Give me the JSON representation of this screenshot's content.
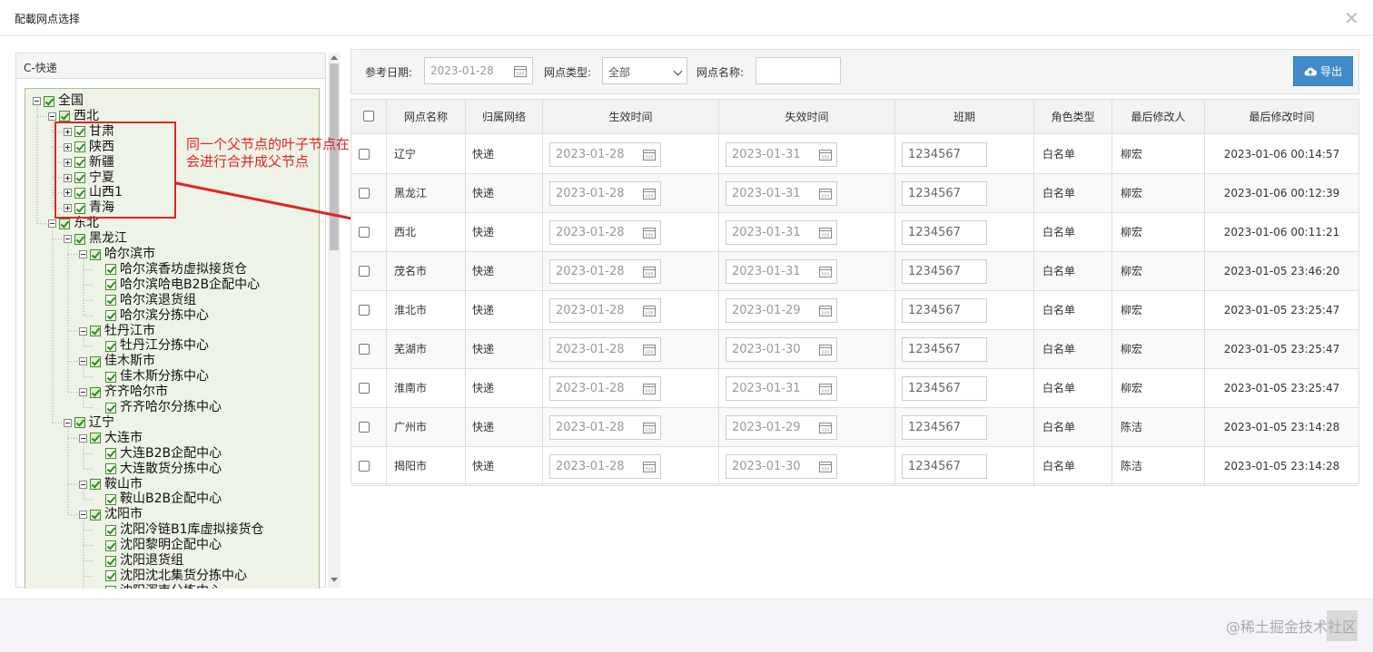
{
  "modal": {
    "title": "配載网点选择"
  },
  "tree": {
    "title": "C-快递",
    "nodes": [
      {
        "label": "全国",
        "level": 0,
        "expander": "minus"
      },
      {
        "label": "西北",
        "level": 1,
        "expander": "minus"
      },
      {
        "label": "甘肃",
        "level": 2,
        "expander": "plus"
      },
      {
        "label": "陕西",
        "level": 2,
        "expander": "plus"
      },
      {
        "label": "新疆",
        "level": 2,
        "expander": "plus"
      },
      {
        "label": "宁夏",
        "level": 2,
        "expander": "plus"
      },
      {
        "label": "山西1",
        "level": 2,
        "expander": "plus"
      },
      {
        "label": "青海",
        "level": 2,
        "expander": "plus"
      },
      {
        "label": "东北",
        "level": 1,
        "expander": "minus"
      },
      {
        "label": "黑龙江",
        "level": 2,
        "expander": "minus"
      },
      {
        "label": "哈尔滨市",
        "level": 3,
        "expander": "minus"
      },
      {
        "label": "哈尔滨香坊虚拟接货仓",
        "level": 4,
        "expander": "none"
      },
      {
        "label": "哈尔滨哈电B2B企配中心",
        "level": 4,
        "expander": "none"
      },
      {
        "label": "哈尔滨退货组",
        "level": 4,
        "expander": "none"
      },
      {
        "label": "哈尔滨分拣中心",
        "level": 4,
        "expander": "none"
      },
      {
        "label": "牡丹江市",
        "level": 3,
        "expander": "minus"
      },
      {
        "label": "牡丹江分拣中心",
        "level": 4,
        "expander": "none"
      },
      {
        "label": "佳木斯市",
        "level": 3,
        "expander": "minus"
      },
      {
        "label": "佳木斯分拣中心",
        "level": 4,
        "expander": "none"
      },
      {
        "label": "齐齐哈尔市",
        "level": 3,
        "expander": "minus"
      },
      {
        "label": "齐齐哈尔分拣中心",
        "level": 4,
        "expander": "none"
      },
      {
        "label": "辽宁",
        "level": 2,
        "expander": "minus"
      },
      {
        "label": "大连市",
        "level": 3,
        "expander": "minus"
      },
      {
        "label": "大连B2B企配中心",
        "level": 4,
        "expander": "none"
      },
      {
        "label": "大连散货分拣中心",
        "level": 4,
        "expander": "none"
      },
      {
        "label": "鞍山市",
        "level": 3,
        "expander": "minus"
      },
      {
        "label": "鞍山B2B企配中心",
        "level": 4,
        "expander": "none"
      },
      {
        "label": "沈阳市",
        "level": 3,
        "expander": "minus"
      },
      {
        "label": "沈阳冷链B1库虚拟接货仓",
        "level": 4,
        "expander": "none"
      },
      {
        "label": "沈阳黎明企配中心",
        "level": 4,
        "expander": "none"
      },
      {
        "label": "沈阳退货组",
        "level": 4,
        "expander": "none"
      },
      {
        "label": "沈阳沈北集货分拣中心",
        "level": 4,
        "expander": "none"
      },
      {
        "label": "沈阳浑南分拣中心",
        "level": 4,
        "expander": "none"
      }
    ]
  },
  "annotation": {
    "line1": "同一个父节点的叶子节点在满足条件时",
    "line2": "会进行合并成父节点",
    "color": "#e02424"
  },
  "toolbar": {
    "ref_date_label": "参考日期:",
    "ref_date_value": "2023-01-28",
    "type_label": "网点类型:",
    "type_value": "全部",
    "name_label": "网点名称:",
    "name_value": "",
    "export_label": "导出",
    "accent": "#428bca"
  },
  "grid": {
    "headers": {
      "name": "网点名称",
      "network": "归属网络",
      "start": "生效时间",
      "end": "失效时间",
      "shift": "班期",
      "role": "角色类型",
      "modifier": "最后修改人",
      "mtime": "最后修改时间"
    },
    "rows": [
      {
        "name": "辽宁",
        "network": "快递",
        "start": "2023-01-28",
        "end": "2023-01-31",
        "shift": "1234567",
        "role": "白名单",
        "modifier": "柳宏",
        "mtime": "2023-01-06 00:14:57"
      },
      {
        "name": "黑龙江",
        "network": "快递",
        "start": "2023-01-28",
        "end": "2023-01-31",
        "shift": "1234567",
        "role": "白名单",
        "modifier": "柳宏",
        "mtime": "2023-01-06 00:12:39"
      },
      {
        "name": "西北",
        "network": "快递",
        "start": "2023-01-28",
        "end": "2023-01-31",
        "shift": "1234567",
        "role": "白名单",
        "modifier": "柳宏",
        "mtime": "2023-01-06 00:11:21"
      },
      {
        "name": "茂名市",
        "network": "快递",
        "start": "2023-01-28",
        "end": "2023-01-31",
        "shift": "1234567",
        "role": "白名单",
        "modifier": "柳宏",
        "mtime": "2023-01-05 23:46:20"
      },
      {
        "name": "淮北市",
        "network": "快递",
        "start": "2023-01-28",
        "end": "2023-01-29",
        "shift": "1234567",
        "role": "白名单",
        "modifier": "柳宏",
        "mtime": "2023-01-05 23:25:47"
      },
      {
        "name": "芜湖市",
        "network": "快递",
        "start": "2023-01-28",
        "end": "2023-01-30",
        "shift": "1234567",
        "role": "白名单",
        "modifier": "柳宏",
        "mtime": "2023-01-05 23:25:47"
      },
      {
        "name": "淮南市",
        "network": "快递",
        "start": "2023-01-28",
        "end": "2023-01-31",
        "shift": "1234567",
        "role": "白名单",
        "modifier": "柳宏",
        "mtime": "2023-01-05 23:25:47"
      },
      {
        "name": "广州市",
        "network": "快递",
        "start": "2023-01-28",
        "end": "2023-01-29",
        "shift": "1234567",
        "role": "白名单",
        "modifier": "陈洁",
        "mtime": "2023-01-05 23:14:28"
      },
      {
        "name": "揭阳市",
        "network": "快递",
        "start": "2023-01-28",
        "end": "2023-01-30",
        "shift": "1234567",
        "role": "白名单",
        "modifier": "陈洁",
        "mtime": "2023-01-05 23:14:28"
      }
    ]
  },
  "footer": {
    "watermark": "@稀土掘金技术社区"
  }
}
